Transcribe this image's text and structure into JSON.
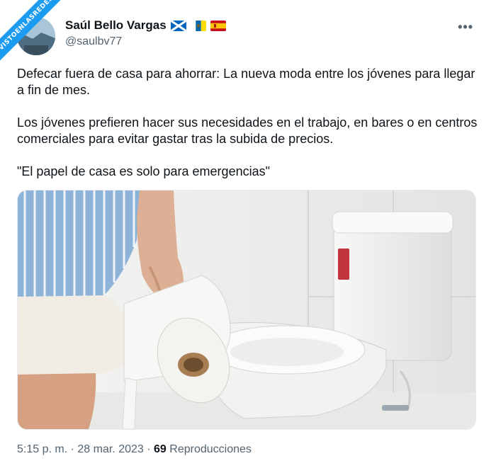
{
  "watermark": {
    "text": "VISTOENLASREDES"
  },
  "author": {
    "name": "Saúl Bello Vargas",
    "handle": "@saulbv77",
    "flags": [
      "scotland-flag-icon",
      "canary-islands-flag-icon",
      "spain-flag-icon"
    ]
  },
  "tweet": {
    "paragraphs": [
      "Defecar fuera de casa para ahorrar: La nueva moda entre los jóvenes para llegar a fin de mes.",
      "Los jóvenes prefieren hacer sus necesidades en el trabajo, en bares o en centros comerciales para evitar gastar tras la subida de precios.",
      "\"El papel de casa es solo para emergencias\""
    ]
  },
  "meta": {
    "time": "5:15 p. m.",
    "separator": "·",
    "date": "28 mar. 2023",
    "separator2": "·",
    "views_count": "69",
    "views_label": "Reproducciones"
  },
  "more_icon": "more-horizontal-icon",
  "colors": {
    "accent": "#1d9bf0",
    "text": "#0f1419",
    "secondary": "#536471"
  }
}
